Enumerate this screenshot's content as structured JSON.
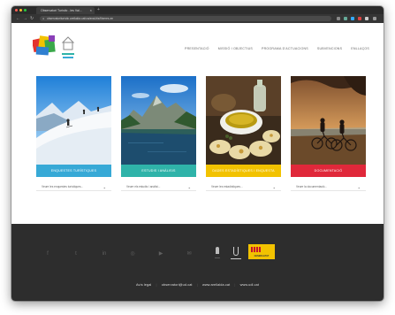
{
  "browser": {
    "tab_title": "Observatori Turístic - les Val...",
    "tab_close": "×",
    "new_tab": "+",
    "url": "observatoriturístic.arellalda.cat/ca/anaLitis/fitxeres-en"
  },
  "site": {
    "nav": [
      "PRESENTACIÓ",
      "MISSIÓ I OBJECTIUS",
      "PROGRAMA D'ACTUACIONS",
      "SUBVENCIONS",
      "ENLLAÇOS"
    ]
  },
  "cards": [
    {
      "label": "ENQUESTES TURÍSTIQUES",
      "color": "#37a9d6",
      "dropdown": "Veure les enquestes turístiques..."
    },
    {
      "label": "ESTUDIS I ANÀLISIS",
      "color": "#2fb3a9",
      "dropdown": "Veure els estudis i anàlisi..."
    },
    {
      "label": "DADES ESTADÍSTIQUES I ENQUESTA",
      "color": "#f2c200",
      "dropdown": "Veure les estadístiques..."
    },
    {
      "label": "DOCUMENTACIÓ",
      "color": "#e0283a",
      "dropdown": "Veure la documentació..."
    }
  ],
  "footer": {
    "social": [
      "f",
      "t",
      "in",
      "◎",
      "▶",
      "✉"
    ],
    "partner_text": "GENERALITAT",
    "contact": {
      "legal": "Avís legal",
      "email": "observatori@ud.cat",
      "web1": "www.arellalda.cat",
      "web2": "www.udl.cat"
    }
  }
}
